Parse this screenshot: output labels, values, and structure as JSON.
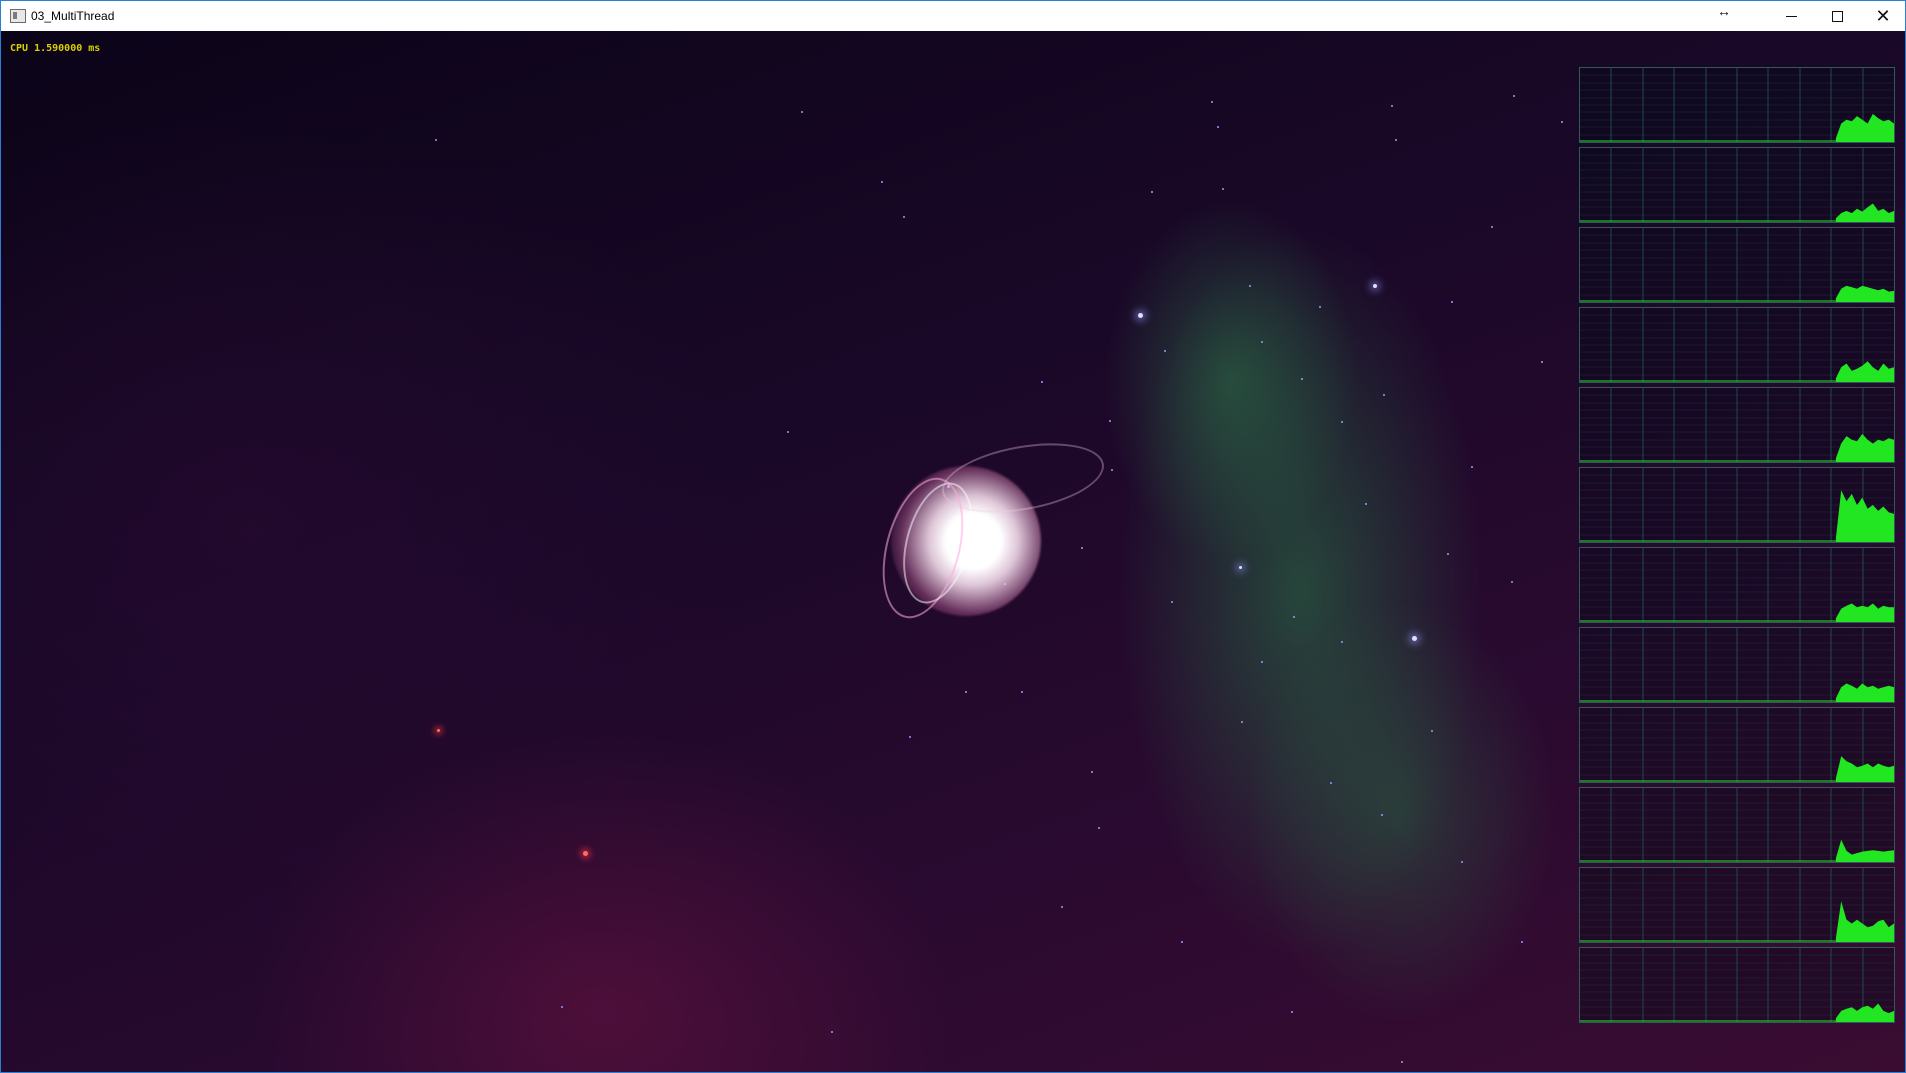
{
  "window": {
    "title": "03_MultiThread",
    "resize_icon": "horizontal-resize-icon",
    "minimize_icon": "minimize-icon",
    "maximize_icon": "maximize-icon",
    "close_icon": "close-icon",
    "resize_glyph": "↔",
    "close_glyph": "✕"
  },
  "overlay": {
    "cpu_text": "CPU 1.590000 ms"
  },
  "colors": {
    "graph_fill": "#22e622",
    "graph_grid": "#1f4a4a",
    "graph_border": "#2d5a5a",
    "cpu_text": "#d8d000"
  },
  "thread_graphs": [
    {
      "samples": [
        0.05,
        0.25,
        0.3,
        0.28,
        0.35,
        0.3,
        0.25,
        0.38,
        0.32,
        0.28,
        0.3,
        0.25
      ]
    },
    {
      "samples": [
        0.05,
        0.12,
        0.15,
        0.12,
        0.18,
        0.14,
        0.2,
        0.25,
        0.15,
        0.18,
        0.12,
        0.15
      ]
    },
    {
      "samples": [
        0.05,
        0.18,
        0.22,
        0.2,
        0.18,
        0.22,
        0.2,
        0.18,
        0.16,
        0.18,
        0.14,
        0.15
      ]
    },
    {
      "samples": [
        0.05,
        0.2,
        0.25,
        0.15,
        0.18,
        0.22,
        0.28,
        0.2,
        0.15,
        0.25,
        0.18,
        0.2
      ]
    },
    {
      "samples": [
        0.05,
        0.25,
        0.35,
        0.3,
        0.28,
        0.38,
        0.3,
        0.25,
        0.3,
        0.28,
        0.32,
        0.3
      ]
    },
    {
      "samples": [
        0.05,
        0.7,
        0.55,
        0.65,
        0.5,
        0.6,
        0.45,
        0.5,
        0.42,
        0.48,
        0.4,
        0.38
      ]
    },
    {
      "samples": [
        0.05,
        0.18,
        0.22,
        0.25,
        0.2,
        0.22,
        0.2,
        0.25,
        0.18,
        0.22,
        0.2,
        0.2
      ]
    },
    {
      "samples": [
        0.05,
        0.2,
        0.25,
        0.22,
        0.18,
        0.25,
        0.2,
        0.22,
        0.18,
        0.2,
        0.22,
        0.2
      ]
    },
    {
      "samples": [
        0.05,
        0.35,
        0.28,
        0.25,
        0.2,
        0.22,
        0.25,
        0.2,
        0.25,
        0.22,
        0.2,
        0.22
      ]
    },
    {
      "samples": [
        0.05,
        0.3,
        0.15,
        0.1,
        0.12,
        0.14,
        0.15,
        0.16,
        0.15,
        0.14,
        0.15,
        0.16
      ]
    },
    {
      "samples": [
        0.05,
        0.55,
        0.3,
        0.25,
        0.3,
        0.25,
        0.2,
        0.22,
        0.28,
        0.3,
        0.2,
        0.25
      ]
    },
    {
      "samples": [
        0.05,
        0.15,
        0.18,
        0.2,
        0.15,
        0.2,
        0.22,
        0.18,
        0.25,
        0.15,
        0.12,
        0.15
      ]
    }
  ]
}
